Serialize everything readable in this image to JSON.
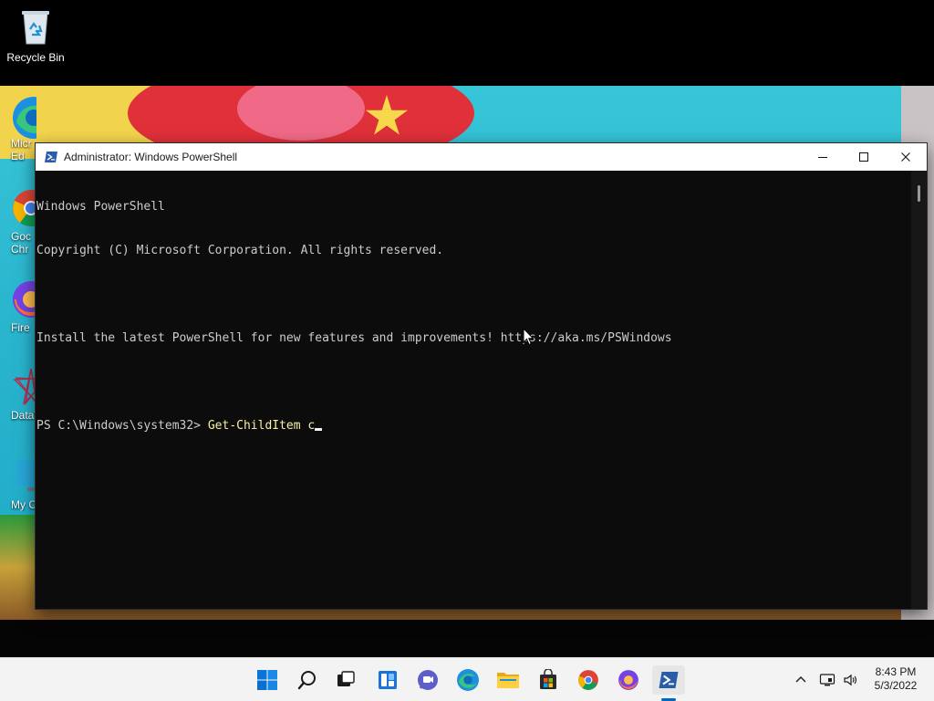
{
  "desktop": {
    "icons": [
      {
        "label": "Recycle Bin"
      },
      {
        "label": "Micr Ed"
      },
      {
        "label": "Goc Chr"
      },
      {
        "label": "Fire"
      },
      {
        "label": "DataW"
      },
      {
        "label": "My Co"
      }
    ]
  },
  "window": {
    "title": "Administrator: Windows PowerShell",
    "console_lines": [
      "Windows PowerShell",
      "Copyright (C) Microsoft Corporation. All rights reserved.",
      "",
      "Install the latest PowerShell for new features and improvements! https://aka.ms/PSWindows",
      ""
    ],
    "prompt": "PS C:\\Windows\\system32> ",
    "command": "Get-ChildItem c"
  },
  "taskbar": {
    "items": [
      "start",
      "search",
      "task-view",
      "widgets",
      "chat",
      "edge",
      "file-explorer",
      "store",
      "chrome",
      "firefox",
      "powershell"
    ],
    "active_item": "powershell"
  },
  "clock": {
    "time": "8:43 PM",
    "date": "5/3/2022"
  },
  "colors": {
    "console_bg": "#0c0c0c",
    "console_text": "#cccccc",
    "command_text": "#f9f1a5",
    "accent": "#0067c0"
  }
}
